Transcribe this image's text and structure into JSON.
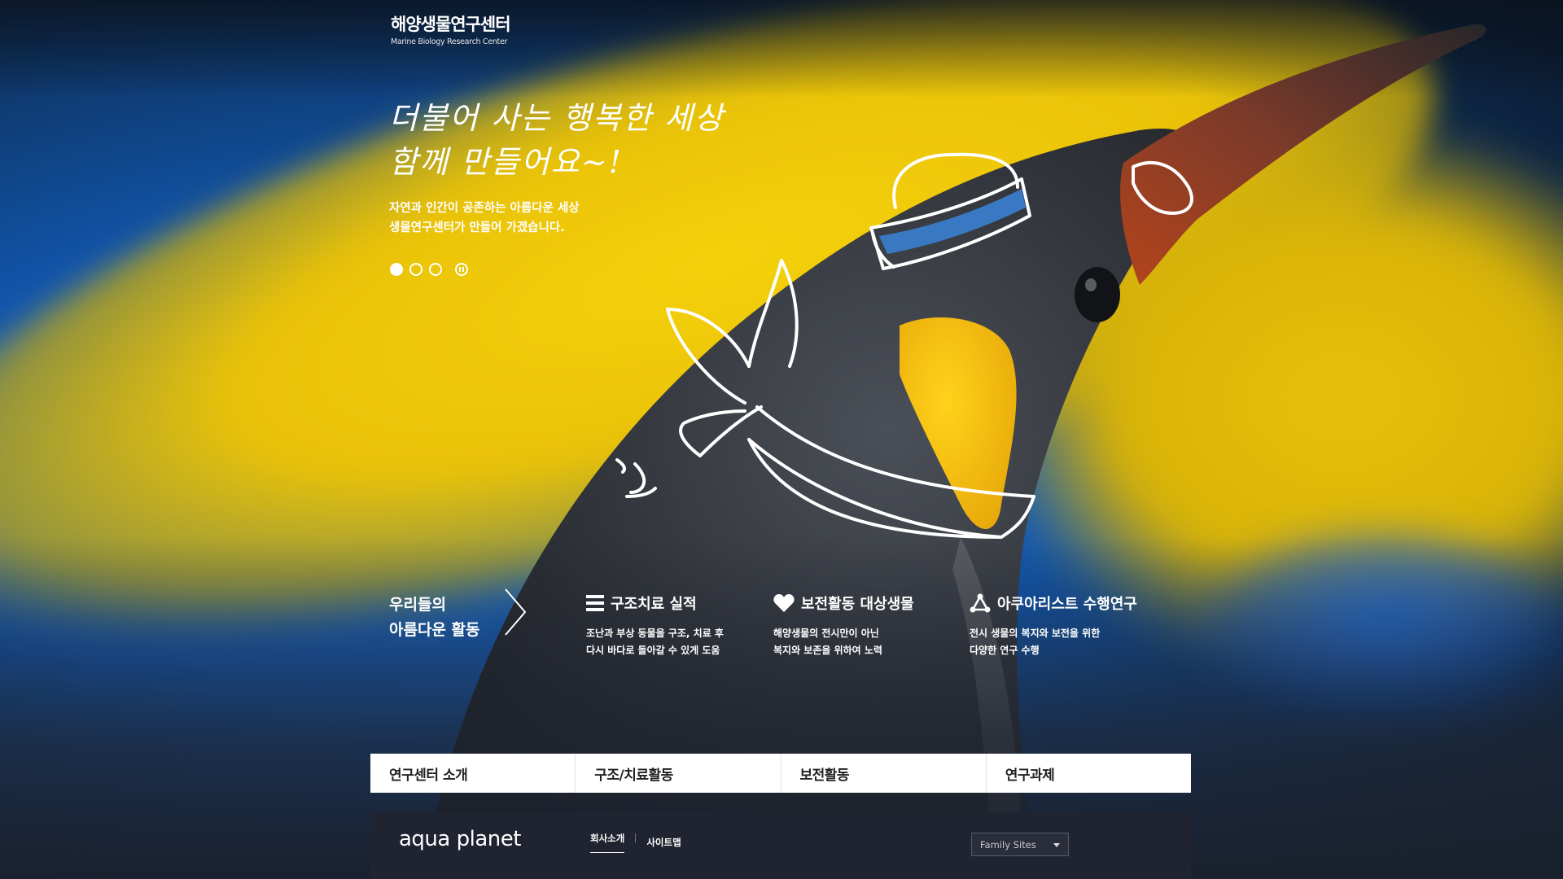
{
  "logo": {
    "title_ko": "해양생물연구센터",
    "title_en": "Marine Biology Research Center"
  },
  "hero": {
    "slogan_line1": "더불어 사는 행복한 세상",
    "slogan_line2": "함께 만들어요~!",
    "sub_line1": "자연과 인간이 공존하는 아름다운 세상",
    "sub_line2": "생물연구센터가 만들어 가겠습니다.",
    "slides_total": 3,
    "slide_active": 1
  },
  "activities": {
    "title_line1": "우리들의",
    "title_line2": "아름다운 활동",
    "items": [
      {
        "icon": "list-icon",
        "title": "구조치료 실적",
        "desc_line1": "조난과 부상 동물을 구조, 치료 후",
        "desc_line2": "다시 바다로 돌아갈 수 있게 도움"
      },
      {
        "icon": "heart-icon",
        "title": "보전활동 대상생물",
        "desc_line1": "해양생물의 전시만이 아닌",
        "desc_line2": "복지와 보존을 위하여 노력"
      },
      {
        "icon": "network-icon",
        "title": "아쿠아리스트 수행연구",
        "desc_line1": "전시 생물의 복지와 보전을 위한",
        "desc_line2": "다양한 연구 수행"
      }
    ]
  },
  "nav": {
    "items": [
      "연구센터 소개",
      "구조/치료활동",
      "보전활동",
      "연구과제"
    ]
  },
  "footer": {
    "brand": "aqua planet",
    "link_company": "회사소개",
    "link_sitemap": "사이트맵",
    "family_sites": "Family Sites"
  },
  "colors": {
    "nav_bg": "#ffffff",
    "footer_bg": "#202430",
    "accent_yellow": "#f5d10b",
    "accent_blue": "#1d6fd0"
  }
}
